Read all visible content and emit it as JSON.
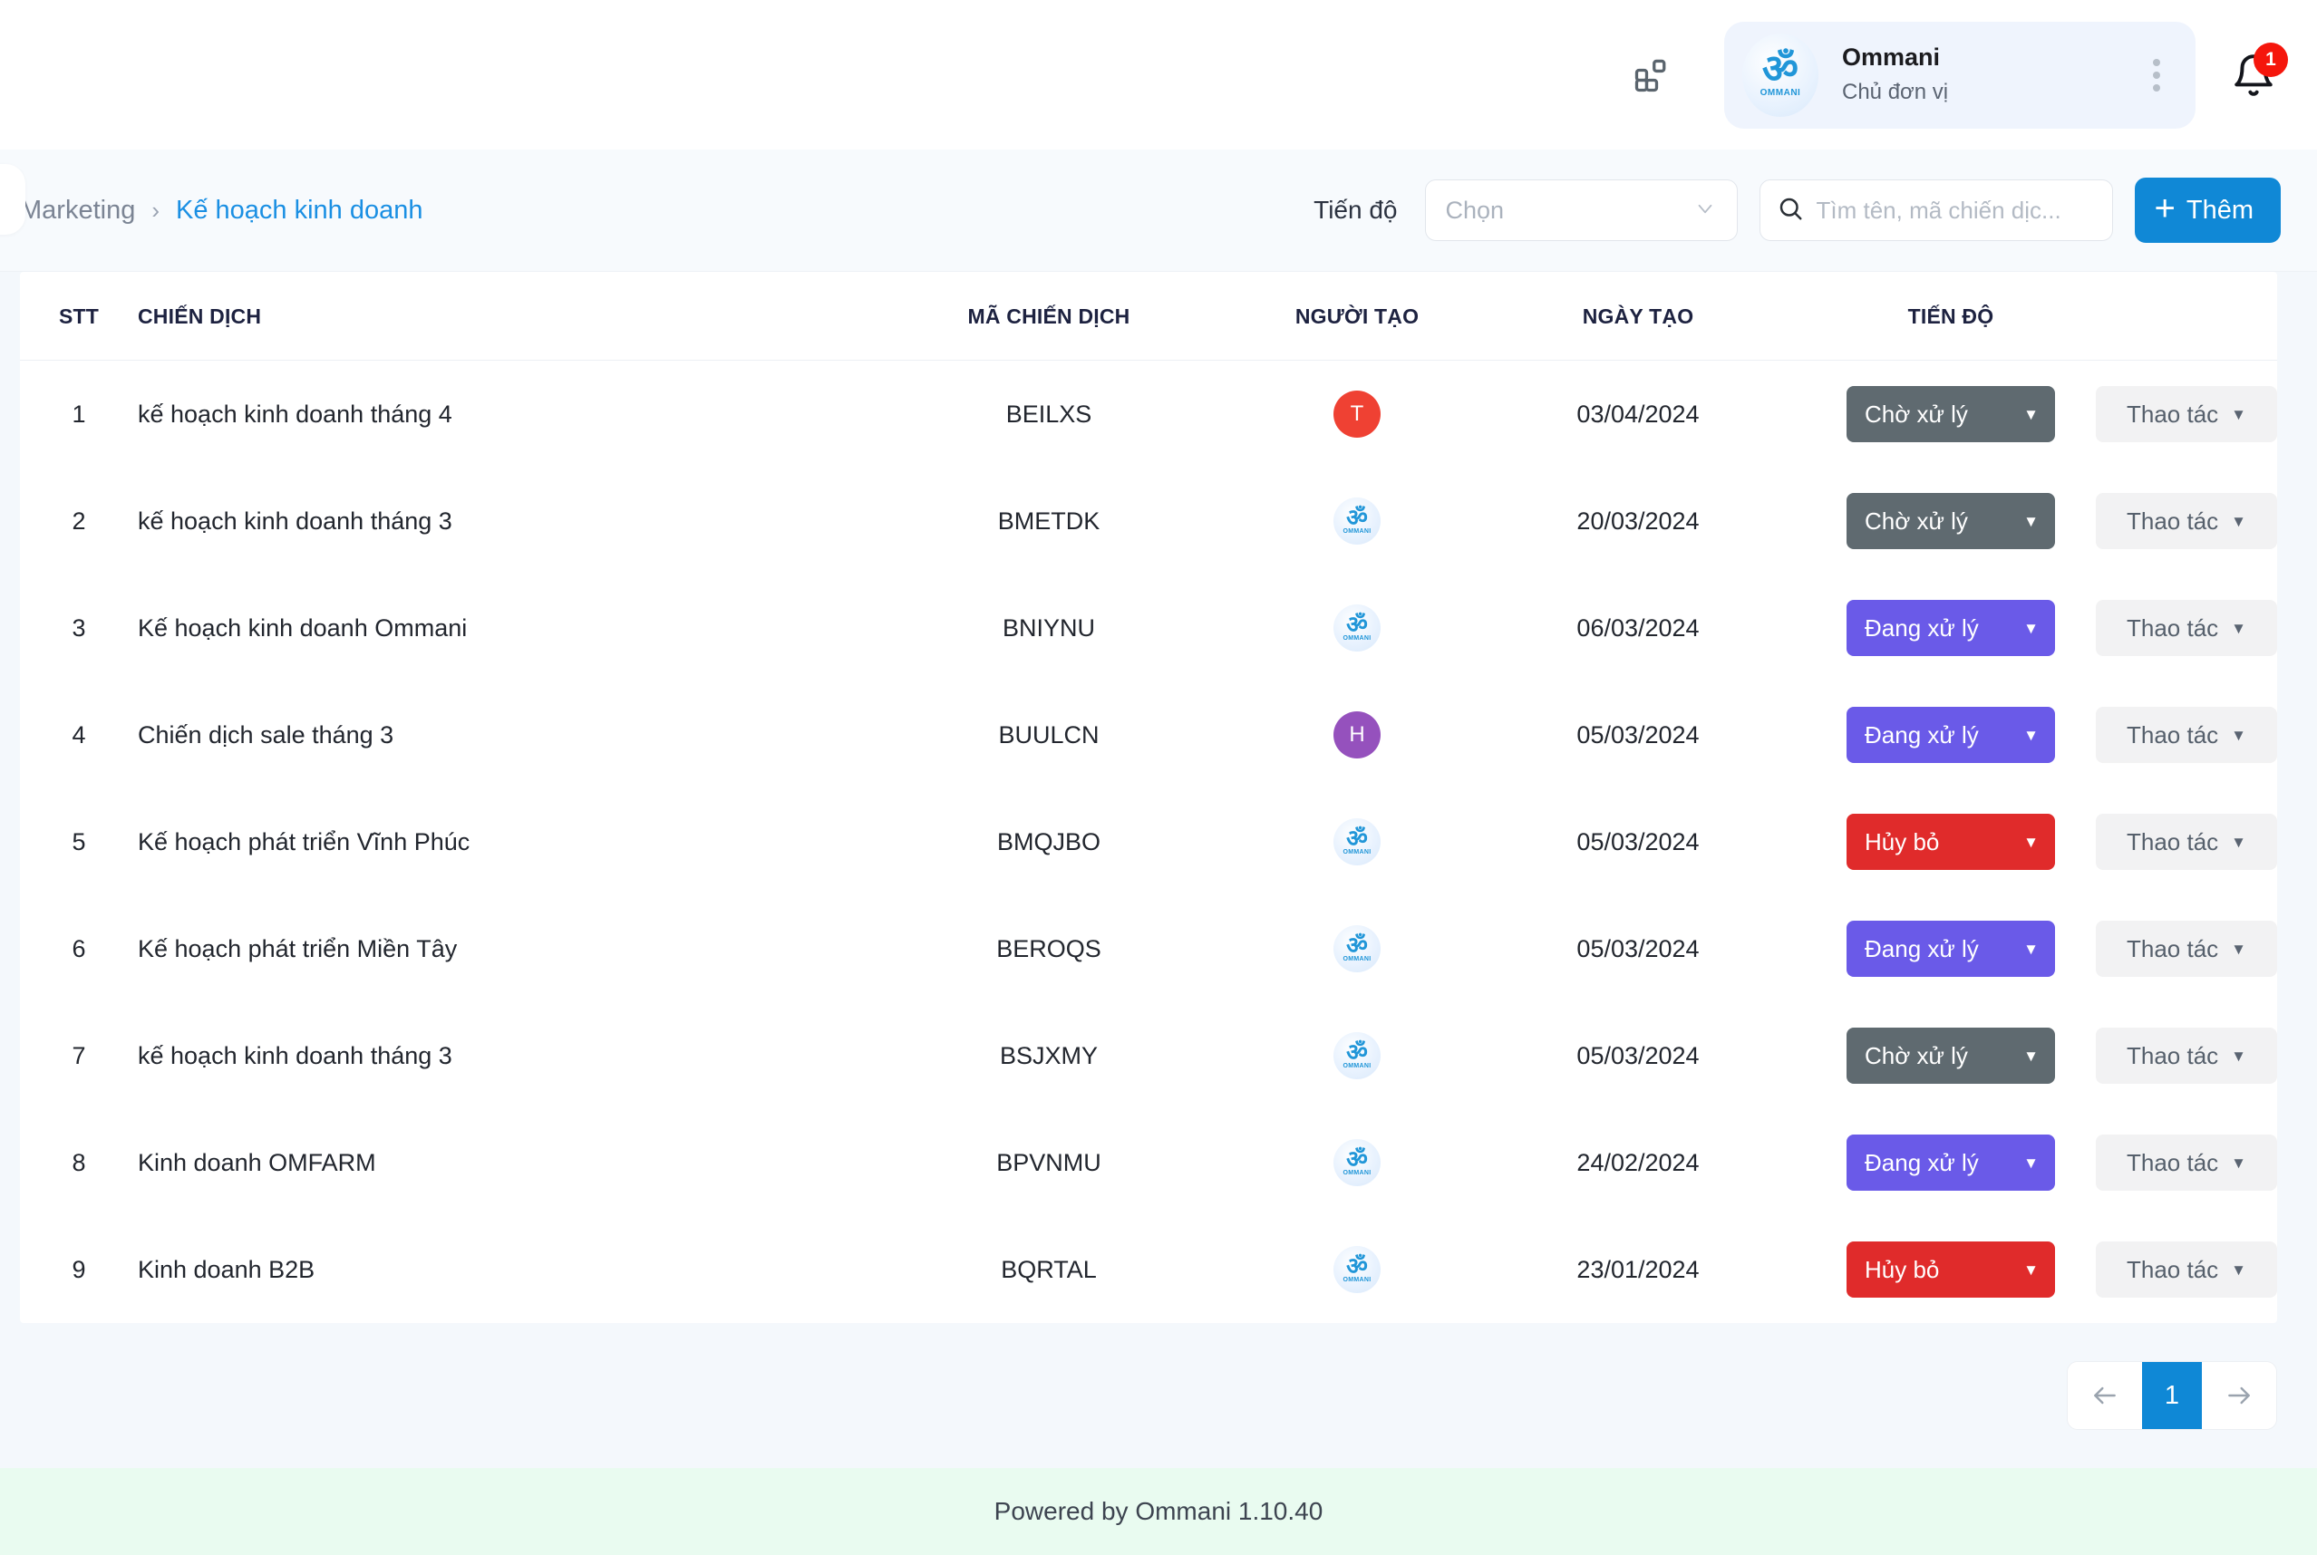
{
  "topbar": {
    "apps_icon": "grid-apps-icon",
    "account": {
      "name": "Ommani",
      "role": "Chủ đơn vị",
      "avatar_glyph": "ॐ",
      "avatar_word": "OMMANI"
    },
    "notification_count": "1"
  },
  "subheader": {
    "breadcrumb": {
      "parent": "Marketing",
      "separator": "›",
      "current": "Kế hoạch kinh doanh"
    },
    "filter_label": "Tiến độ",
    "select_value": "Chọn",
    "search_placeholder": "Tìm tên, mã chiến dịc...",
    "search_value": "",
    "add_label": "Thêm",
    "add_plus": "+"
  },
  "table": {
    "headers": {
      "stt": "STT",
      "name": "CHIẾN DỊCH",
      "code": "MÃ CHIẾN DỊCH",
      "creator": "NGƯỜI TẠO",
      "date": "NGÀY TẠO",
      "progress": "TIẾN ĐỘ",
      "action": ""
    },
    "action_label": "Thao tác",
    "rows": [
      {
        "stt": "1",
        "name": "kế hoạch kinh doanh tháng 4",
        "code": "BEILXS",
        "creator": {
          "type": "initial",
          "letter": "T",
          "color": "#ef4133"
        },
        "date": "03/04/2024",
        "status": {
          "label": "Chờ xử lý",
          "color": "#5f6a70"
        }
      },
      {
        "stt": "2",
        "name": "kế hoạch kinh doanh tháng 3",
        "code": "BMETDK",
        "creator": {
          "type": "logo",
          "glyph": "ॐ",
          "word": "OMMANI"
        },
        "date": "20/03/2024",
        "status": {
          "label": "Chờ xử lý",
          "color": "#5f6a70"
        }
      },
      {
        "stt": "3",
        "name": "Kế hoạch kinh doanh Ommani",
        "code": "BNIYNU",
        "creator": {
          "type": "logo",
          "glyph": "ॐ",
          "word": "OMMANI"
        },
        "date": "06/03/2024",
        "status": {
          "label": "Đang xử lý",
          "color": "#6a5ae8"
        }
      },
      {
        "stt": "4",
        "name": "Chiến dịch sale tháng 3",
        "code": "BUULCN",
        "creator": {
          "type": "initial",
          "letter": "H",
          "color": "#9551bd"
        },
        "date": "05/03/2024",
        "status": {
          "label": "Đang xử lý",
          "color": "#6a5ae8"
        }
      },
      {
        "stt": "5",
        "name": "Kế hoạch phát triển Vĩnh Phúc",
        "code": "BMQJBO",
        "creator": {
          "type": "logo",
          "glyph": "ॐ",
          "word": "OMMANI"
        },
        "date": "05/03/2024",
        "status": {
          "label": "Hủy bỏ",
          "color": "#e02b2b"
        }
      },
      {
        "stt": "6",
        "name": "Kế hoạch phát triển Miền Tây",
        "code": "BEROQS",
        "creator": {
          "type": "logo",
          "glyph": "ॐ",
          "word": "OMMANI"
        },
        "date": "05/03/2024",
        "status": {
          "label": "Đang xử lý",
          "color": "#6a5ae8"
        }
      },
      {
        "stt": "7",
        "name": "kế hoạch kinh doanh tháng 3",
        "code": "BSJXMY",
        "creator": {
          "type": "logo",
          "glyph": "ॐ",
          "word": "OMMANI"
        },
        "date": "05/03/2024",
        "status": {
          "label": "Chờ xử lý",
          "color": "#5f6a70"
        }
      },
      {
        "stt": "8",
        "name": "Kinh doanh OMFARM",
        "code": "BPVNMU",
        "creator": {
          "type": "logo",
          "glyph": "ॐ",
          "word": "OMMANI"
        },
        "date": "24/02/2024",
        "status": {
          "label": "Đang xử lý",
          "color": "#6a5ae8"
        }
      },
      {
        "stt": "9",
        "name": "Kinh doanh B2B",
        "code": "BQRTAL",
        "creator": {
          "type": "logo",
          "glyph": "ॐ",
          "word": "OMMANI"
        },
        "date": "23/01/2024",
        "status": {
          "label": "Hủy bỏ",
          "color": "#e02b2b"
        }
      }
    ]
  },
  "pagination": {
    "prev_icon": "arrow-left-icon",
    "next_icon": "arrow-right-icon",
    "current_page": "1"
  },
  "footer": {
    "text": "Powered by Ommani 1.10.40"
  },
  "colors": {
    "accent": "#1088d6",
    "status_pending": "#5f6a70",
    "status_processing": "#6a5ae8",
    "status_cancelled": "#e02b2b",
    "footer_bg": "#e9fbf0",
    "page_bg": "#f4f8fc"
  }
}
